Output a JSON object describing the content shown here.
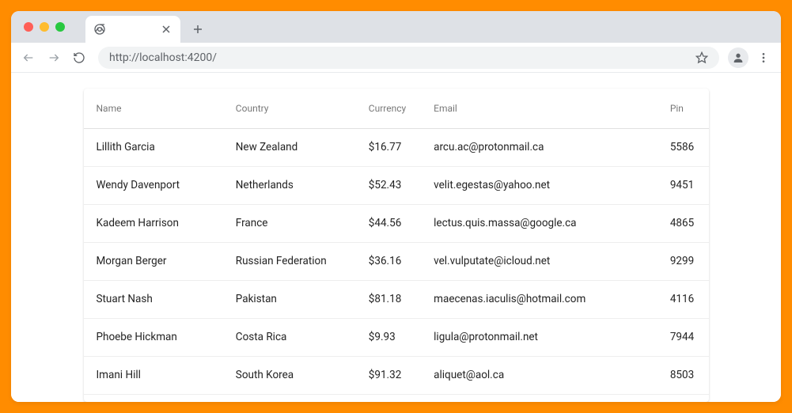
{
  "browser": {
    "url": "http://localhost:4200/",
    "tab_title": ""
  },
  "table": {
    "headers": {
      "name": "Name",
      "country": "Country",
      "currency": "Currency",
      "email": "Email",
      "pin": "Pin"
    },
    "rows": [
      {
        "name": "Lillith Garcia",
        "country": "New Zealand",
        "currency": "$16.77",
        "email": "arcu.ac@protonmail.ca",
        "pin": "5586"
      },
      {
        "name": "Wendy Davenport",
        "country": "Netherlands",
        "currency": "$52.43",
        "email": "velit.egestas@yahoo.net",
        "pin": "9451"
      },
      {
        "name": "Kadeem Harrison",
        "country": "France",
        "currency": "$44.56",
        "email": "lectus.quis.massa@google.ca",
        "pin": "4865"
      },
      {
        "name": "Morgan Berger",
        "country": "Russian Federation",
        "currency": "$36.16",
        "email": "vel.vulputate@icloud.net",
        "pin": "9299"
      },
      {
        "name": "Stuart Nash",
        "country": "Pakistan",
        "currency": "$81.18",
        "email": "maecenas.iaculis@hotmail.com",
        "pin": "4116"
      },
      {
        "name": "Phoebe Hickman",
        "country": "Costa Rica",
        "currency": "$9.93",
        "email": "ligula@protonmail.net",
        "pin": "7944"
      },
      {
        "name": "Imani Hill",
        "country": "South Korea",
        "currency": "$91.32",
        "email": "aliquet@aol.ca",
        "pin": "8503"
      }
    ]
  }
}
